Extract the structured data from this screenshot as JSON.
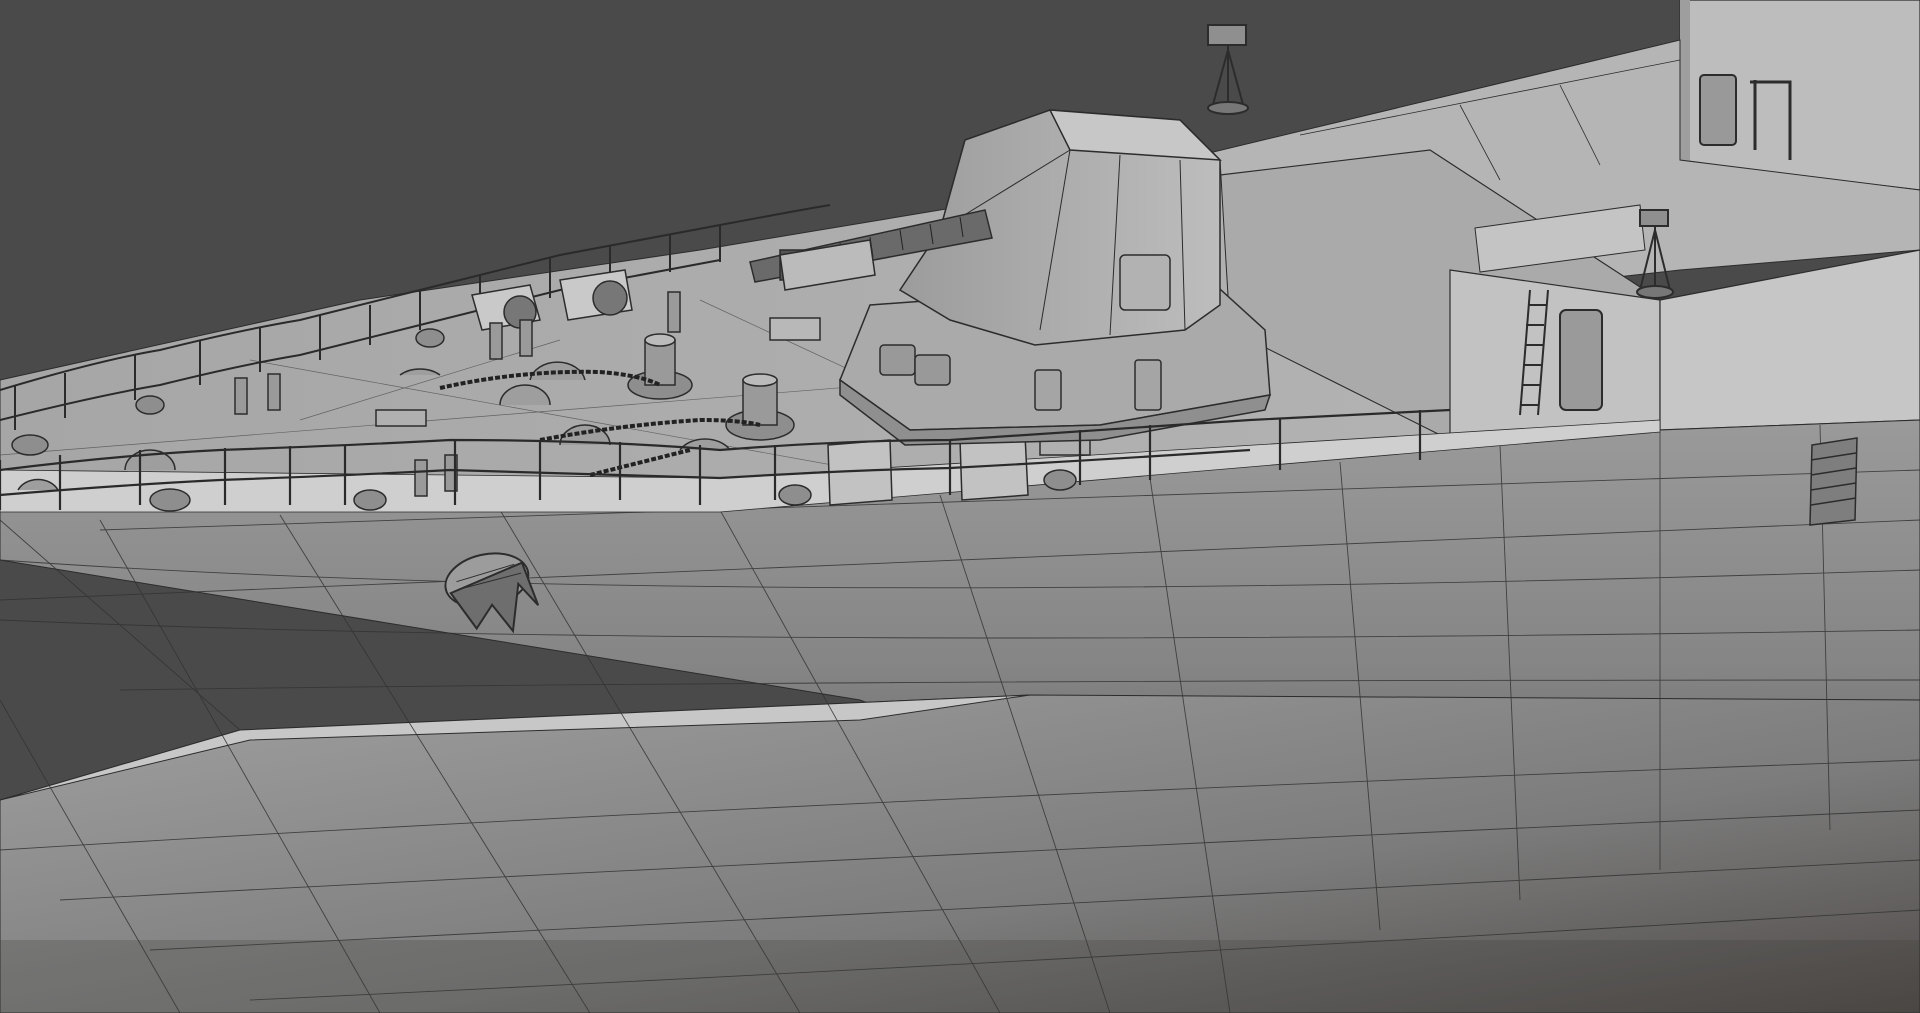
{
  "scene": {
    "subject": "wireframe-naval-ship-bow",
    "colors": {
      "background": "#4a4a4a",
      "hull_light": "#8e8e8e",
      "hull_dark": "#5c5c5c",
      "deck": "#a9a9a9",
      "deck_shadow": "#8a8a8a",
      "superstructure": "#b8b8b8",
      "edges": "#2c2c2c"
    },
    "icons": [
      "naval-gun-turret-icon",
      "anchor-windlass-icon",
      "emblem-crest-icon",
      "antenna-mast-icon",
      "ventilation-fan-icon",
      "ladder-icon"
    ]
  }
}
